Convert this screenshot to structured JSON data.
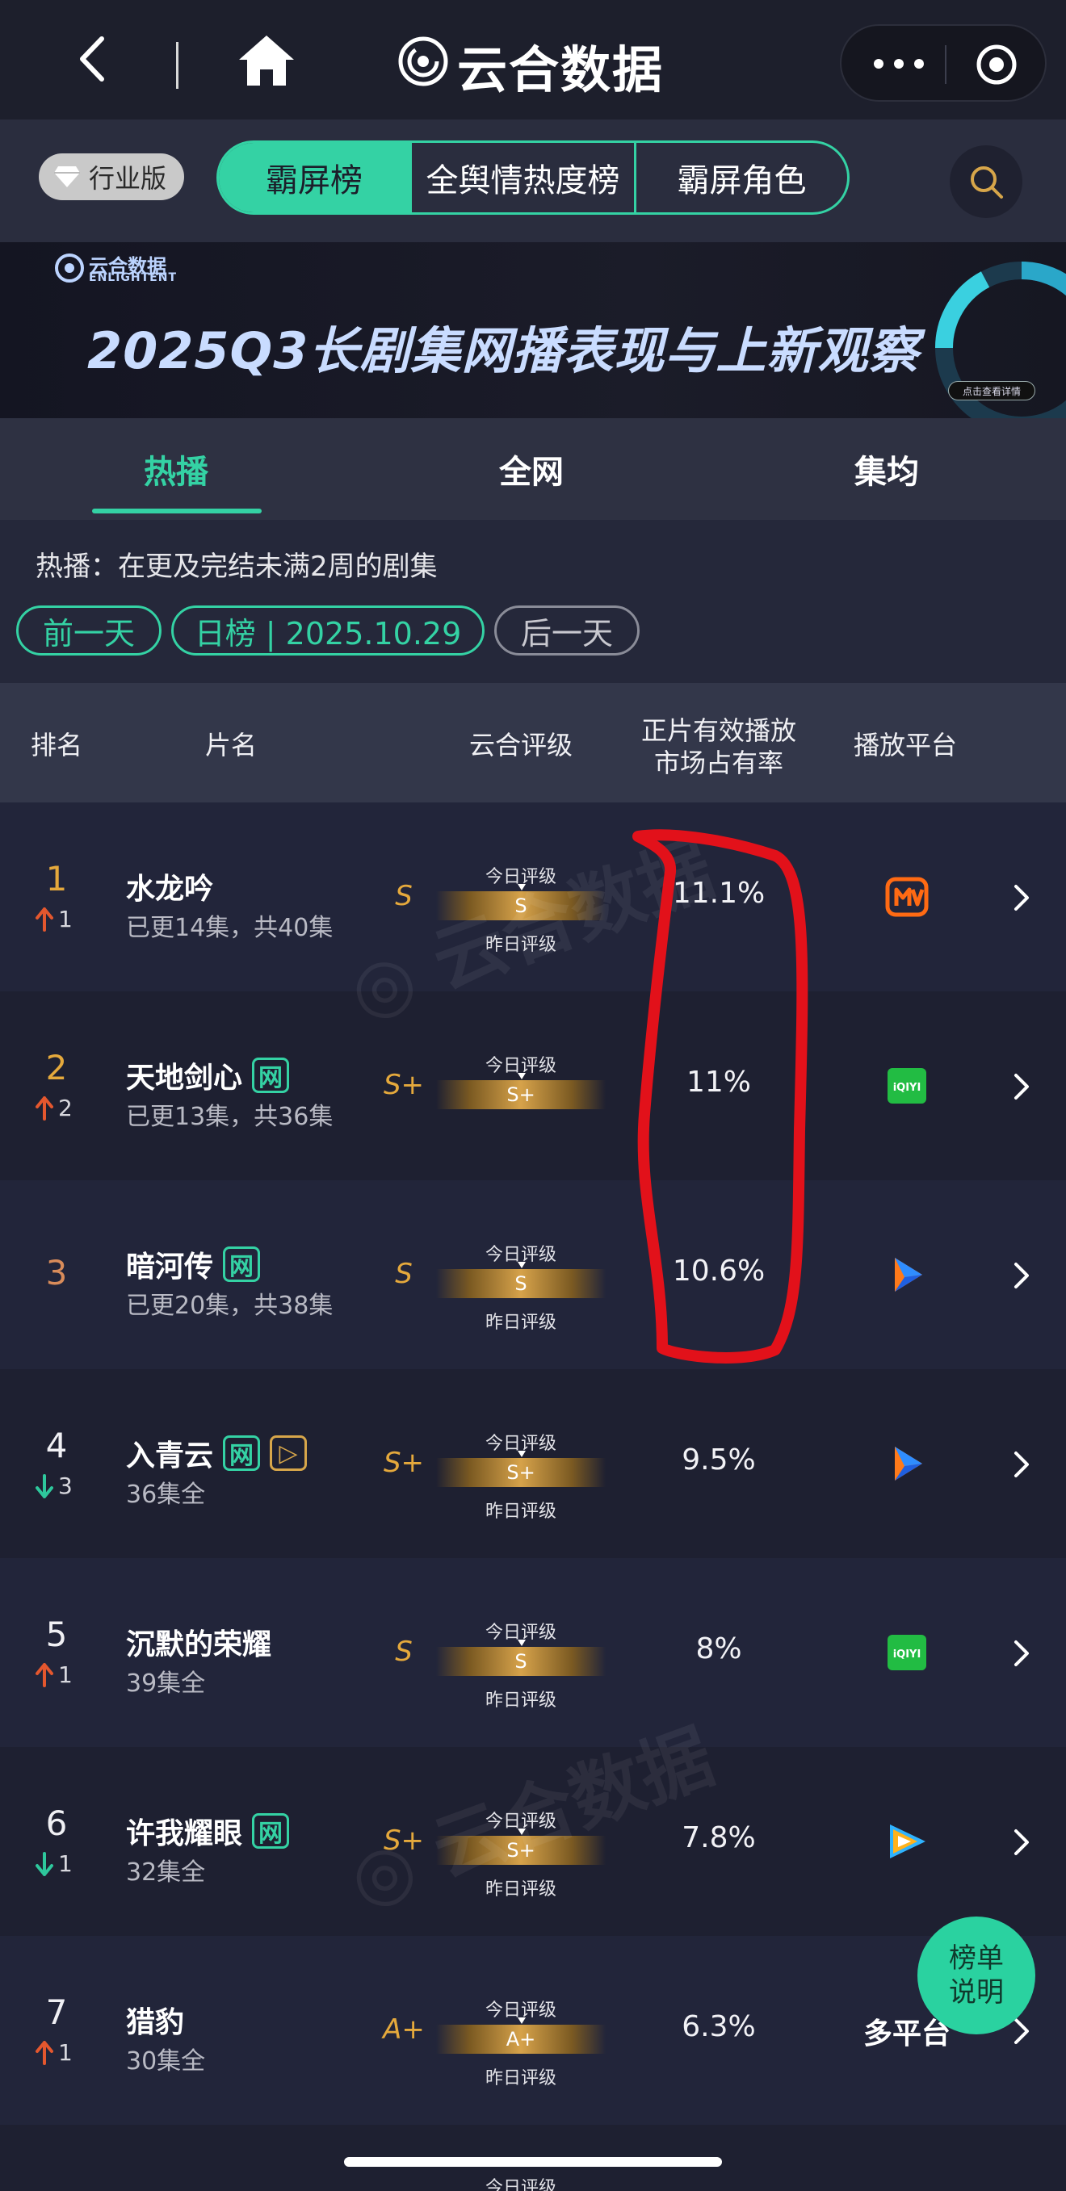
{
  "nav": {
    "title": "云合数据"
  },
  "subhead": {
    "industry_label": "行业版",
    "segments": [
      "霸屏榜",
      "全舆情热度榜",
      "霸屏角色"
    ]
  },
  "banner": {
    "brand": "云合数据",
    "brand_en": "ENLIGHTENT",
    "title": "2025Q3长剧集网播表现与上新观察",
    "detail": "点击查看详情"
  },
  "tabs": [
    "热播",
    "全网",
    "集均"
  ],
  "info": {
    "description": "热播：在更及完结未满2周的剧集",
    "prev_day": "前一天",
    "date_label": "日榜 | 2025.10.29",
    "next_day": "后一天"
  },
  "table": {
    "headers": {
      "rank": "排名",
      "title": "片名",
      "grade": "云合评级",
      "share_line1": "正片有效播放",
      "share_line2": "市场占有率",
      "platform": "播放平台"
    },
    "today_label": "今日评级",
    "yesterday_label": "昨日评级",
    "rows": [
      {
        "rank": "1",
        "trend": "1",
        "trend_dir": "up",
        "name": "水龙吟",
        "tags": [],
        "episodes": "已更14集，共40集",
        "grade_yesterday": "S",
        "grade_today": "S",
        "share": "11.1%",
        "platform": "mango"
      },
      {
        "rank": "2",
        "trend": "2",
        "trend_dir": "up",
        "name": "天地剑心",
        "tags": [
          "网"
        ],
        "episodes": "已更13集，共36集",
        "grade_yesterday": "S+",
        "grade_today": "S+",
        "share": "11%",
        "platform": "iqiyi"
      },
      {
        "rank": "3",
        "trend": "",
        "trend_dir": "none",
        "name": "暗河传",
        "tags": [
          "网"
        ],
        "episodes": "已更20集，共38集",
        "grade_yesterday": "S",
        "grade_today": "S",
        "share": "10.6%",
        "platform": "youku"
      },
      {
        "rank": "4",
        "trend": "3",
        "trend_dir": "down",
        "name": "入青云",
        "tags": [
          "网",
          "▷"
        ],
        "episodes": "36集全",
        "grade_yesterday": "S+",
        "grade_today": "S+",
        "share": "9.5%",
        "platform": "youku"
      },
      {
        "rank": "5",
        "trend": "1",
        "trend_dir": "up",
        "name": "沉默的荣耀",
        "tags": [],
        "episodes": "39集全",
        "grade_yesterday": "S",
        "grade_today": "S",
        "share": "8%",
        "platform": "iqiyi"
      },
      {
        "rank": "6",
        "trend": "1",
        "trend_dir": "down",
        "name": "许我耀眼",
        "tags": [
          "网"
        ],
        "episodes": "32集全",
        "grade_yesterday": "S+",
        "grade_today": "S+",
        "share": "7.8%",
        "platform": "tencent"
      },
      {
        "rank": "7",
        "trend": "1",
        "trend_dir": "up",
        "name": "猎豹",
        "tags": [],
        "episodes": "30集全",
        "grade_yesterday": "A+",
        "grade_today": "A+",
        "share": "6.3%",
        "platform": "多平台"
      }
    ]
  },
  "float_button": {
    "line1": "榜单",
    "line2": "说明"
  },
  "colors": {
    "accent": "#34d2a4",
    "gold": "#e5a93c",
    "up": "#e4572e",
    "down": "#2ec79c",
    "annotation": "#e2111a"
  }
}
